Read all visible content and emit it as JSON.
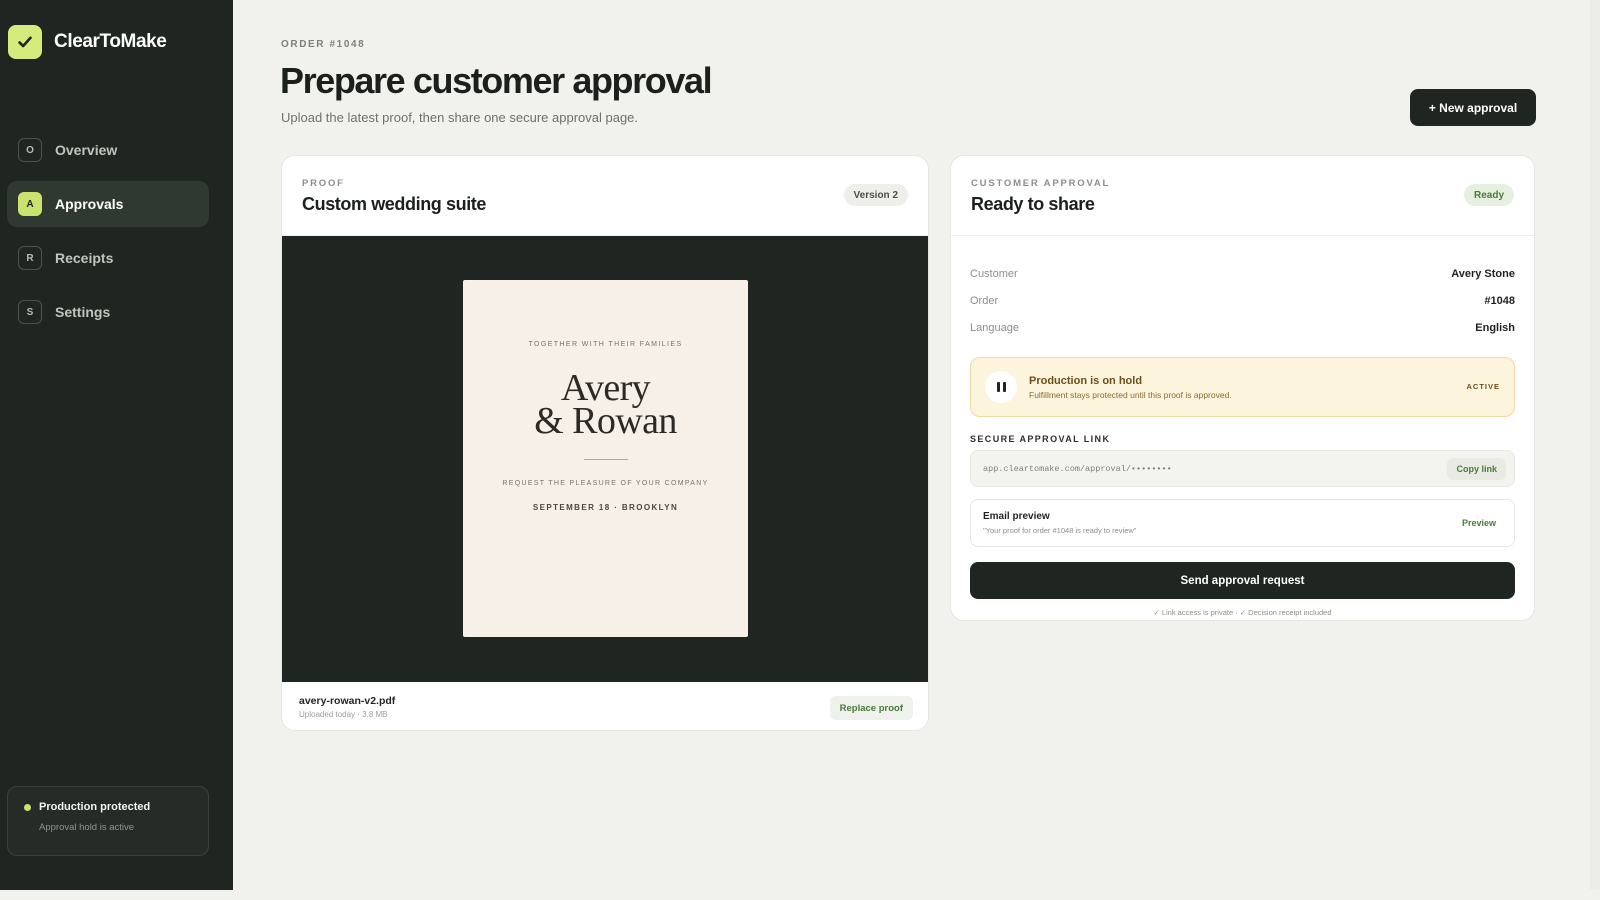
{
  "app": {
    "name": "ClearToMake"
  },
  "sidebar": {
    "items": [
      {
        "badge": "O",
        "label": "Overview"
      },
      {
        "badge": "A",
        "label": "Approvals"
      },
      {
        "badge": "R",
        "label": "Receipts"
      },
      {
        "badge": "S",
        "label": "Settings"
      }
    ],
    "active_index": 1,
    "status": {
      "title": "Production protected",
      "subtitle": "Approval hold is active"
    }
  },
  "header": {
    "eyebrow": "ORDER #1048",
    "title": "Prepare customer approval",
    "subtitle": "Upload the latest proof, then share one secure approval page.",
    "new_button": "+ New approval"
  },
  "proof": {
    "eyebrow": "PROOF",
    "title": "Custom wedding suite",
    "version": "Version 2",
    "invitation": {
      "top_line": "TOGETHER WITH THEIR FAMILIES",
      "name_1": "Avery",
      "name_2": "& Rowan",
      "request": "REQUEST THE PLEASURE OF YOUR COMPANY",
      "date": "SEPTEMBER 18 · BROOKLYN"
    },
    "file": {
      "name": "avery-rowan-v2.pdf",
      "meta": "Uploaded today · 3.8 MB"
    },
    "replace_button": "Replace proof"
  },
  "approval": {
    "eyebrow": "CUSTOMER APPROVAL",
    "title": "Ready to share",
    "status": "Ready",
    "details": [
      {
        "key": "Customer",
        "value": "Avery Stone"
      },
      {
        "key": "Order",
        "value": "#1048"
      },
      {
        "key": "Language",
        "value": "English"
      }
    ],
    "hold": {
      "title": "Production is on hold",
      "subtitle": "Fulfillment stays protected until this proof is approved.",
      "tag": "ACTIVE"
    },
    "link": {
      "label": "SECURE APPROVAL LINK",
      "value": "app.cleartomake.com/approval/••••••••",
      "copy_button": "Copy link"
    },
    "email": {
      "title": "Email preview",
      "subtitle": "\"Your proof for order #1048 is ready to review\"",
      "preview_button": "Preview"
    },
    "send_button": "Send approval request",
    "note": "✓ Link access is private · ✓ Decision receipt included"
  },
  "colors": {
    "sidebar": "#1f2621",
    "accent": "#c9e36e",
    "hold_bg": "#fdf4de",
    "success": "#4a7a3a"
  }
}
